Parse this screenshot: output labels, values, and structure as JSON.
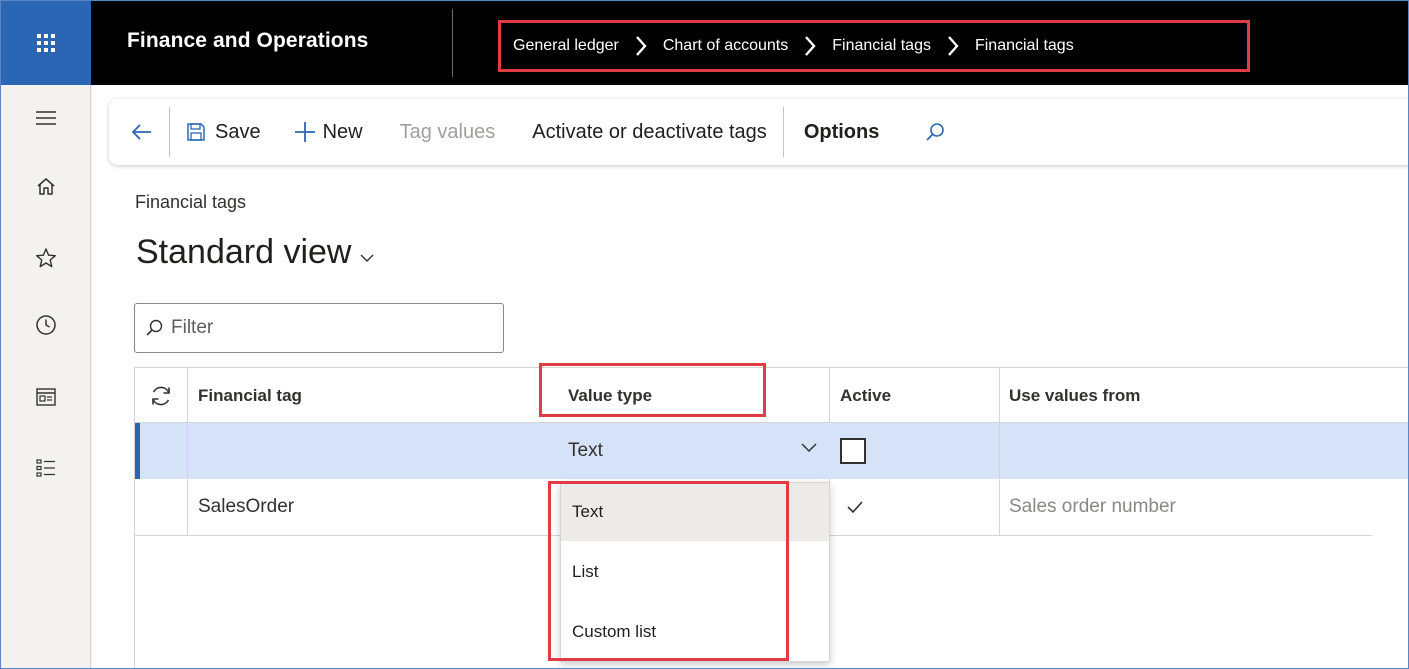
{
  "app": {
    "title": "Finance and Operations"
  },
  "breadcrumb": {
    "items": [
      "General ledger",
      "Chart of accounts",
      "Financial tags",
      "Financial tags"
    ]
  },
  "actionpane": {
    "save_label": "Save",
    "new_label": "New",
    "tag_values_label": "Tag values",
    "activate_label": "Activate or deactivate tags",
    "options_label": "Options"
  },
  "form": {
    "caption": "Financial tags",
    "view_title": "Standard view",
    "filter_placeholder": "Filter"
  },
  "grid": {
    "headers": {
      "financial_tag": "Financial tag",
      "value_type": "Value type",
      "active": "Active",
      "use_values_from": "Use values from"
    },
    "rows": [
      {
        "financial_tag": "",
        "value_type": "Text",
        "active": false,
        "use_values_from": ""
      },
      {
        "financial_tag": "SalesOrder",
        "value_type": "",
        "active": true,
        "use_values_from": "Sales order number"
      }
    ]
  },
  "dropdown": {
    "options": [
      "Text",
      "List",
      "Custom list"
    ],
    "highlighted": "Text"
  },
  "colors": {
    "accent": "#2b66b5",
    "annotation": "#e03c45",
    "selected_row": "#d5e2f7"
  }
}
